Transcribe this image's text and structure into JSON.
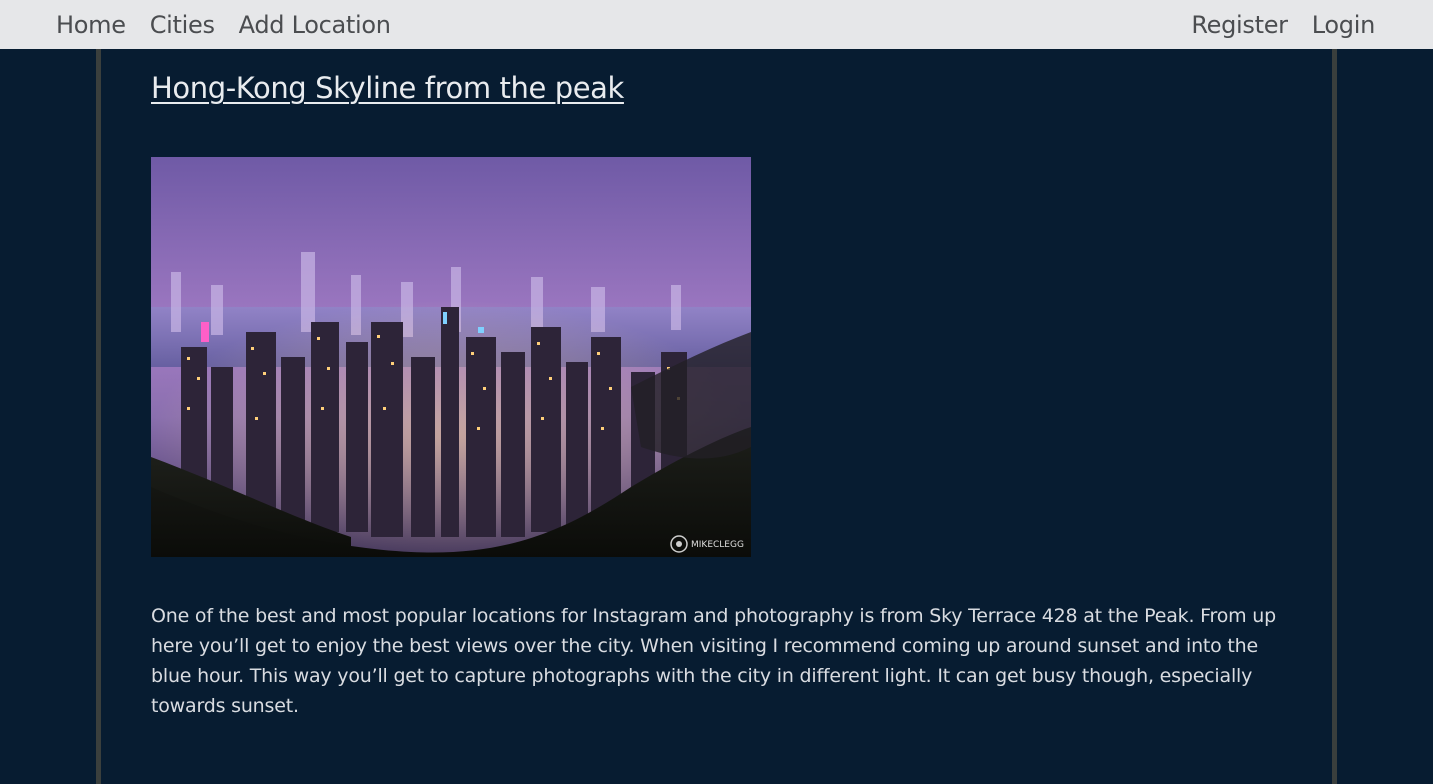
{
  "nav": {
    "left": [
      {
        "label": "Home"
      },
      {
        "label": "Cities"
      },
      {
        "label": "Add Location"
      }
    ],
    "right": [
      {
        "label": "Register"
      },
      {
        "label": "Login"
      }
    ]
  },
  "location": {
    "title": "Hong-Kong Skyline from the peak",
    "description": "One of the best and most popular locations for Instagram and photography is from Sky Terrace 428 at the Peak. From up here you’ll get to enjoy the best views over the city. When visiting I recommend coming up around sunset and into the blue hour. This way you’ll get to capture photographs with the city in different light. It can get busy though, especially towards sunset.",
    "photo_watermark": "MIKECLEGG"
  },
  "colors": {
    "background": "#071c31",
    "navbar": "#e6e7e9",
    "nav_text": "#4b4d50",
    "border": "#3a3f3d",
    "text": "#d9dce1"
  }
}
